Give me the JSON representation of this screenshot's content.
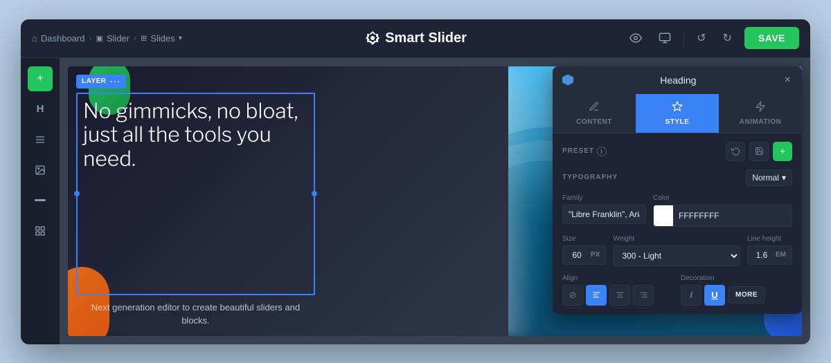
{
  "app": {
    "title": "Smart Slider",
    "logo_symbol": "Ś"
  },
  "topbar": {
    "breadcrumb": [
      {
        "label": "Dashboard",
        "icon": "home"
      },
      {
        "label": "Slider",
        "icon": "slider"
      },
      {
        "label": "Slides",
        "icon": "slides",
        "has_dropdown": true
      }
    ],
    "save_label": "SAVE",
    "undo_icon": "↺",
    "redo_icon": "↻",
    "preview_icon": "👁",
    "responsive_icon": "⬜"
  },
  "sidebar": {
    "buttons": [
      {
        "icon": "+",
        "label": "add",
        "style": "green"
      },
      {
        "icon": "H",
        "label": "heading"
      },
      {
        "icon": "≡",
        "label": "list"
      },
      {
        "icon": "🖼",
        "label": "image"
      },
      {
        "icon": "—",
        "label": "divider"
      },
      {
        "icon": "▦",
        "label": "grid"
      }
    ]
  },
  "layer": {
    "badge_text": "LAYER",
    "dots": "···"
  },
  "slide": {
    "heading": "No gimmicks, no bloat, just all the tools you need.",
    "subtext": "Next generation editor to create beautiful sliders and blocks."
  },
  "panel": {
    "title": "Heading",
    "close_icon": "×",
    "tabs": [
      {
        "label": "CONTENT",
        "icon": "✏",
        "id": "content"
      },
      {
        "label": "STYLE",
        "icon": "🎨",
        "id": "style",
        "active": true
      },
      {
        "label": "ANIMATION",
        "icon": "⚡",
        "id": "animation"
      }
    ],
    "preset": {
      "label": "PRESET",
      "info": "i",
      "reset_icon": "↺",
      "save_icon": "💾",
      "add_icon": "+"
    },
    "typography": {
      "label": "TYPOGRAPHY",
      "normal_label": "Normal",
      "dropdown_arrow": "▾",
      "family_label": "Family",
      "family_value": "\"Libre Franklin\", Arial",
      "color_label": "Color",
      "color_value": "FFFFFFFF",
      "color_hex": "#FFFFFF",
      "size_label": "Size",
      "size_value": "60",
      "size_unit": "PX",
      "weight_label": "Weight",
      "weight_value": "300 - Light",
      "line_height_label": "Line height",
      "line_height_value": "1.6",
      "line_height_unit": "EM",
      "align_label": "Align",
      "align_options": [
        {
          "icon": "⊘",
          "label": "none",
          "active": false
        },
        {
          "icon": "≡",
          "label": "left",
          "active": true
        },
        {
          "icon": "☰",
          "label": "center",
          "active": false
        },
        {
          "icon": "≡",
          "label": "right",
          "active": false
        }
      ],
      "decoration_label": "Decoration",
      "decoration_options": [
        {
          "icon": "I",
          "label": "italic",
          "active": false
        },
        {
          "icon": "U",
          "label": "underline",
          "active": true
        }
      ],
      "more_label": "MORE"
    }
  }
}
